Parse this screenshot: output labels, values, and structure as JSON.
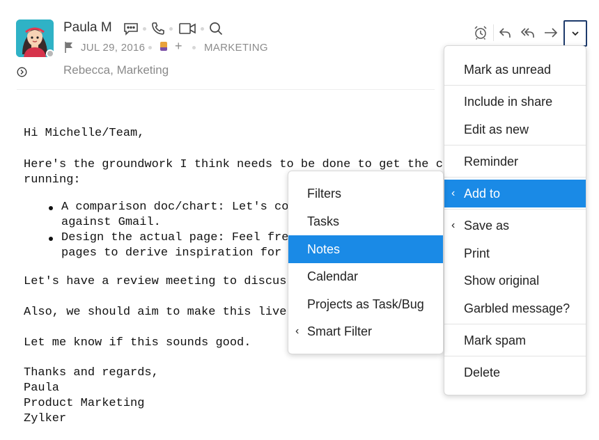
{
  "header": {
    "sender_name": "Paula M",
    "date": "JUL 29, 2016",
    "label": "MARKETING",
    "add_symbol": "+",
    "recipient_1": "Rebecca",
    "recipient_separator": ", ",
    "recipient_2": "Marketing",
    "icons": [
      "chat-icon",
      "phone-icon",
      "video-icon",
      "search-icon",
      "flag-icon",
      "expand-icon"
    ]
  },
  "toolbar": {
    "icons": [
      "alarm-icon",
      "reply-icon",
      "reply-all-icon",
      "forward-icon",
      "chevron-down-icon"
    ],
    "active_border_color": "#1d3a6b"
  },
  "email_body": {
    "greeting": "Hi Michelle/Team,",
    "intro_line1": "Here's the groundwork I think needs to be done to get the compar",
    "intro_line2": "running:",
    "bullet1_line1": "A comparison doc/chart: Let's comp",
    "bullet1_line2": "against Gmail.",
    "bullet2_line1": "Design the actual page: Feel free to",
    "bullet2_line2": "pages to derive inspiration for our p",
    "review": "Let's have a review meeting to discuss the",
    "aim": "Also, we should aim to make this live by n",
    "closing": "Let me know if this sounds good.",
    "signoff": "Thanks and regards,",
    "sig_name": "Paula",
    "sig_title": "Product Marketing",
    "sig_company": "Zylker"
  },
  "more_menu": {
    "items": [
      {
        "label": "Mark as unread"
      },
      {
        "label": "Include in share"
      },
      {
        "label": "Edit as new"
      },
      {
        "label": "Reminder"
      },
      {
        "label": "Add to",
        "active": true,
        "submenu": true
      },
      {
        "label": "Save as",
        "submenu": true
      },
      {
        "label": "Print"
      },
      {
        "label": "Show original"
      },
      {
        "label": "Garbled message?"
      },
      {
        "label": "Mark spam"
      },
      {
        "label": "Delete"
      }
    ],
    "submenu_indicator": "‹"
  },
  "add_to_submenu": {
    "items": [
      {
        "label": "Filters"
      },
      {
        "label": "Tasks"
      },
      {
        "label": "Notes",
        "active": true
      },
      {
        "label": "Calendar"
      },
      {
        "label": "Projects as Task/Bug"
      },
      {
        "label": "Smart Filter",
        "submenu": true
      }
    ]
  },
  "colors": {
    "accent": "#1a8ae6",
    "avatar_bg": "#2fb2c6",
    "muted_text": "#8c8c8c"
  }
}
